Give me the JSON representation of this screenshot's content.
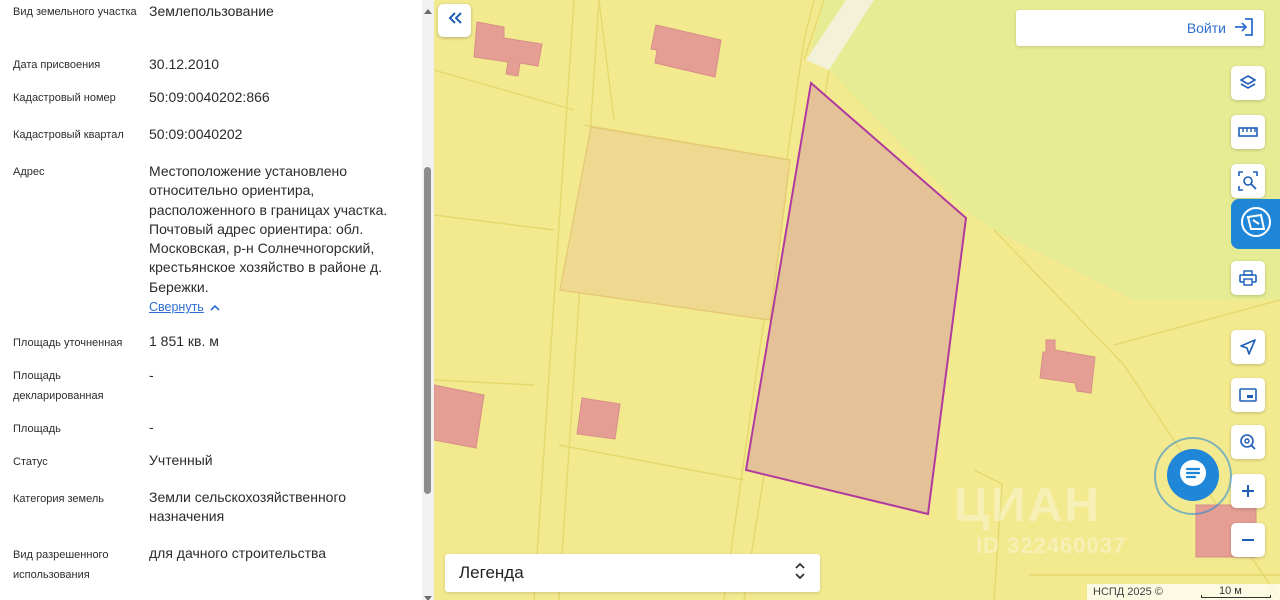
{
  "panel": {
    "rows": [
      {
        "label": "Вид земельного участка",
        "value": "Землепользование"
      },
      {
        "label": "Дата присвоения",
        "value": "30.12.2010"
      },
      {
        "label": "Кадастровый номер",
        "value": "50:09:0040202:866"
      },
      {
        "label": "Кадастровый квартал",
        "value": "50:09:0040202"
      },
      {
        "label": "Адрес",
        "value": "Местоположение установлено относительно ориентира, расположенного в границах участка. Почтовый адрес ориентира: обл. Московская, р-н Солнечногорский, крестьянское хозяйство в районе д. Бережки."
      },
      {
        "label": "Площадь уточненная",
        "value": "1 851 кв. м"
      },
      {
        "label": "Площадь декларированная",
        "value": "-"
      },
      {
        "label": "Площадь",
        "value": "-"
      },
      {
        "label": "Статус",
        "value": "Учтенный"
      },
      {
        "label": "Категория земель",
        "value": "Земли сельскохозяйственного назначения"
      },
      {
        "label": "Вид разрешенного использования",
        "value": "для дачного строительства"
      }
    ],
    "collapse_label": "Свернуть"
  },
  "map": {
    "login_label": "Войти",
    "legend_label": "Легенда",
    "copyright": "НСПД 2025 ©",
    "scale_label": "10 м",
    "watermark": "ЦИАН",
    "watermark_id": "ID 322460037",
    "tools": [
      "layers-icon",
      "ruler-icon",
      "search-area-icon",
      "active-tool-icon",
      "print-icon",
      "locate-icon",
      "minimap-icon",
      "geo-pin-icon",
      "zoom-in-icon",
      "zoom-out-icon"
    ]
  },
  "colors": {
    "accent": "#1f86d8",
    "link": "#2f6fd1",
    "map_land": "#f3e98f",
    "parcel_fill": "#e4c197",
    "parcel_border": "#b03aa0",
    "building": "#e59e94"
  }
}
